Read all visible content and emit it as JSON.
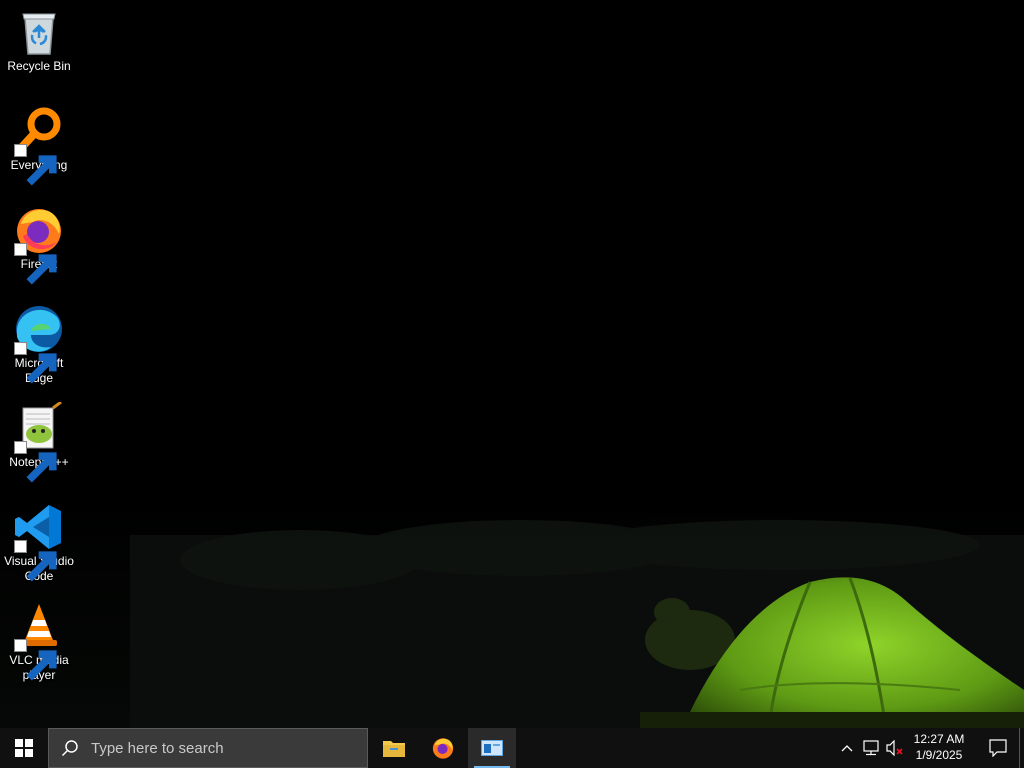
{
  "desktop": {
    "icons": [
      {
        "label": "Recycle Bin",
        "icon": "recycle-bin-icon"
      },
      {
        "label": "Everything",
        "icon": "everything-icon"
      },
      {
        "label": "Firefox",
        "icon": "firefox-icon"
      },
      {
        "label": "Microsoft Edge",
        "icon": "edge-icon"
      },
      {
        "label": "Notepad++",
        "icon": "notepadpp-icon"
      },
      {
        "label": "Visual Studio Code",
        "icon": "vscode-icon"
      },
      {
        "label": "VLC media player",
        "icon": "vlc-icon"
      }
    ]
  },
  "taskbar": {
    "search_placeholder": "Type here to search",
    "pinned": [
      {
        "name": "File Explorer",
        "icon": "file-explorer-icon"
      },
      {
        "name": "Firefox",
        "icon": "firefox-icon"
      },
      {
        "name": "Active window",
        "icon": "window-icon",
        "active": true
      }
    ],
    "tray": {
      "chevron": "chevron-up-icon",
      "network": "network-icon",
      "volume": "volume-muted-icon"
    },
    "clock": {
      "time": "12:27 AM",
      "date": "1/9/2025"
    },
    "accent": "#76b9ed"
  }
}
